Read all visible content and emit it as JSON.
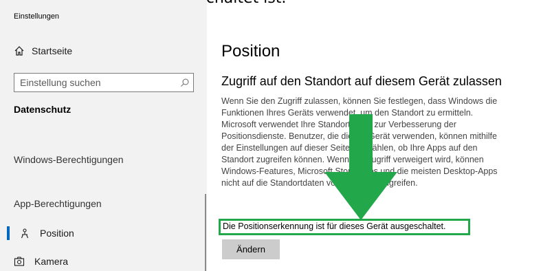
{
  "caption": "Positionserkennung ausgeschaltet ist.",
  "window": {
    "title": "Einstellungen"
  },
  "sidebar": {
    "home_label": "Startseite",
    "search_placeholder": "Einstellung suchen",
    "section": "Datenschutz",
    "group_windows": "Windows-Berechtigungen",
    "group_app": "App-Berechtigungen",
    "nav": [
      {
        "label": "Position",
        "icon": "position-icon",
        "selected": true
      },
      {
        "label": "Kamera",
        "icon": "camera-icon",
        "selected": false
      }
    ]
  },
  "main": {
    "title": "Position",
    "heading": "Zugriff auf den Standort auf diesem Gerät zulassen",
    "description": "Wenn Sie den Zugriff zulassen, können Sie festlegen, dass Windows die Funktionen Ihres Geräts verwendet, um den Standort zu ermitteln. Microsoft verwendet Ihre Standortdaten zur Verbesserung der Positionsdienste. Benutzer, die dieses Gerät verwenden, können mithilfe der Einstellungen auf dieser Seite auswählen, ob Ihre Apps auf den Standort zugreifen können. Wenn der Zugriff verweigert wird, können Windows-Features, Microsoft Store-Apps und die meisten Desktop-Apps nicht auf die Standortdaten von Windows zugreifen.",
    "status": "Die Positionserkennung ist für dieses Gerät ausgeschaltet.",
    "change_button": "Ändern"
  },
  "colors": {
    "accent": "#0067c0",
    "highlight": "#22a74a",
    "sidebar_bg": "#f2f2f2",
    "button_bg": "#cccccc"
  }
}
